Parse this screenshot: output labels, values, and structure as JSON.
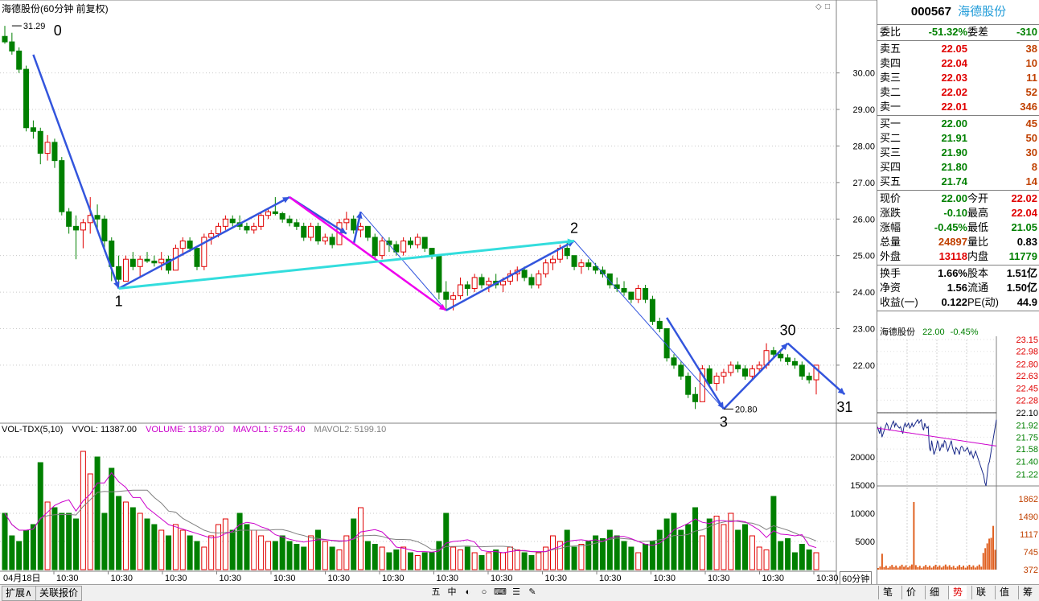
{
  "header": {
    "title": "海德股份(60分钟 前复权)",
    "corner_icons": [
      "◇",
      "□"
    ]
  },
  "chart_data": {
    "type": "candlestick",
    "price_ylim": [
      20.5,
      31.6
    ],
    "price_ticks": [
      "30.00",
      "29.00",
      "28.00",
      "27.00",
      "26.00",
      "25.00",
      "24.00",
      "23.00",
      "22.00"
    ],
    "x_labels": [
      "04月18日",
      "10:30",
      "10:30",
      "10:30",
      "10:30",
      "10:30",
      "10:30",
      "10:30",
      "10:30",
      "10:30",
      "10:30",
      "10:30",
      "10:30",
      "10:30",
      "10:30",
      "10:30"
    ],
    "candles": [
      [
        31.0,
        31.29,
        30.8,
        30.85
      ],
      [
        30.85,
        31.1,
        30.5,
        30.6
      ],
      [
        30.6,
        30.7,
        30.0,
        30.1
      ],
      [
        30.1,
        30.2,
        28.4,
        28.5
      ],
      [
        28.5,
        28.7,
        28.2,
        28.4
      ],
      [
        28.4,
        28.5,
        27.5,
        27.8
      ],
      [
        27.8,
        28.3,
        27.6,
        28.1
      ],
      [
        28.1,
        28.2,
        27.4,
        27.6
      ],
      [
        27.6,
        27.7,
        26.1,
        26.2
      ],
      [
        26.2,
        26.3,
        25.6,
        25.8
      ],
      [
        25.8,
        26.1,
        24.9,
        25.7
      ],
      [
        25.7,
        26.0,
        25.2,
        25.9
      ],
      [
        25.9,
        26.6,
        25.6,
        26.1
      ],
      [
        26.1,
        26.4,
        25.7,
        26.0
      ],
      [
        26.0,
        26.1,
        25.1,
        25.4
      ],
      [
        25.4,
        25.5,
        24.3,
        24.7
      ],
      [
        24.7,
        25.0,
        24.1,
        24.35
      ],
      [
        24.3,
        25.0,
        24.3,
        24.9
      ],
      [
        24.9,
        25.1,
        24.6,
        24.7
      ],
      [
        24.7,
        25.0,
        24.4,
        24.9
      ],
      [
        24.9,
        25.1,
        24.8,
        24.85
      ],
      [
        24.85,
        25.0,
        24.7,
        24.8
      ],
      [
        24.8,
        25.1,
        24.6,
        24.9
      ],
      [
        24.9,
        25.0,
        24.5,
        24.6
      ],
      [
        24.6,
        25.3,
        24.6,
        25.2
      ],
      [
        25.2,
        25.5,
        25.0,
        25.4
      ],
      [
        25.4,
        25.5,
        25.1,
        25.2
      ],
      [
        25.2,
        25.2,
        24.6,
        24.7
      ],
      [
        24.7,
        25.6,
        24.6,
        25.5
      ],
      [
        25.5,
        25.7,
        25.3,
        25.6
      ],
      [
        25.6,
        25.9,
        25.5,
        25.8
      ],
      [
        25.8,
        26.1,
        25.7,
        26.0
      ],
      [
        26.0,
        26.1,
        25.8,
        25.9
      ],
      [
        25.9,
        26.1,
        25.7,
        25.8
      ],
      [
        25.8,
        25.9,
        25.6,
        25.7
      ],
      [
        25.7,
        25.9,
        25.6,
        25.8
      ],
      [
        25.8,
        26.2,
        25.7,
        26.1
      ],
      [
        26.1,
        26.3,
        26.0,
        26.2
      ],
      [
        26.2,
        26.6,
        26.1,
        26.15
      ],
      [
        26.15,
        26.2,
        25.9,
        26.0
      ],
      [
        26.0,
        26.1,
        25.8,
        25.9
      ],
      [
        25.9,
        26.0,
        25.7,
        25.8
      ],
      [
        25.8,
        25.9,
        25.4,
        25.5
      ],
      [
        25.5,
        25.9,
        25.4,
        25.8
      ],
      [
        25.8,
        25.9,
        25.3,
        25.4
      ],
      [
        25.4,
        25.6,
        25.3,
        25.5
      ],
      [
        25.5,
        25.6,
        25.2,
        25.3
      ],
      [
        25.3,
        26.0,
        25.3,
        25.9
      ],
      [
        25.9,
        26.2,
        25.7,
        26.0
      ],
      [
        26.0,
        26.1,
        25.6,
        25.7
      ],
      [
        25.7,
        25.9,
        25.5,
        25.8
      ],
      [
        25.8,
        25.8,
        25.4,
        25.5
      ],
      [
        25.5,
        25.6,
        24.9,
        25.0
      ],
      [
        25.0,
        25.5,
        24.9,
        25.4
      ],
      [
        25.4,
        25.5,
        25.1,
        25.3
      ],
      [
        25.3,
        25.4,
        25.0,
        25.1
      ],
      [
        25.1,
        25.5,
        25.0,
        25.4
      ],
      [
        25.4,
        25.5,
        25.2,
        25.3
      ],
      [
        25.3,
        25.6,
        25.2,
        25.5
      ],
      [
        25.5,
        25.5,
        25.1,
        25.2
      ],
      [
        25.2,
        25.2,
        24.9,
        25.0
      ],
      [
        25.0,
        25.0,
        23.8,
        24.0
      ],
      [
        24.0,
        24.3,
        23.5,
        23.8
      ],
      [
        23.8,
        24.0,
        23.5,
        23.9
      ],
      [
        23.9,
        24.4,
        23.8,
        24.2
      ],
      [
        24.2,
        24.3,
        23.9,
        24.1
      ],
      [
        24.1,
        24.5,
        24.0,
        24.4
      ],
      [
        24.4,
        24.5,
        24.1,
        24.2
      ],
      [
        24.2,
        24.4,
        24.0,
        24.3
      ],
      [
        24.3,
        24.5,
        24.1,
        24.2
      ],
      [
        24.2,
        24.4,
        24.0,
        24.3
      ],
      [
        24.3,
        24.6,
        24.2,
        24.5
      ],
      [
        24.5,
        24.7,
        24.3,
        24.6
      ],
      [
        24.6,
        24.7,
        24.3,
        24.4
      ],
      [
        24.4,
        24.5,
        24.1,
        24.2
      ],
      [
        24.2,
        24.6,
        24.1,
        24.5
      ],
      [
        24.5,
        24.9,
        24.4,
        24.8
      ],
      [
        24.8,
        25.0,
        24.6,
        24.9
      ],
      [
        24.9,
        25.3,
        24.8,
        25.2
      ],
      [
        25.2,
        25.4,
        24.9,
        25.0
      ],
      [
        25.0,
        25.0,
        24.6,
        24.7
      ],
      [
        24.7,
        24.9,
        24.5,
        24.8
      ],
      [
        24.8,
        24.9,
        24.6,
        24.7
      ],
      [
        24.7,
        24.8,
        24.5,
        24.6
      ],
      [
        24.6,
        24.7,
        24.4,
        24.5
      ],
      [
        24.5,
        24.5,
        24.1,
        24.2
      ],
      [
        24.2,
        24.4,
        24.0,
        24.1
      ],
      [
        24.1,
        24.3,
        23.9,
        24.0
      ],
      [
        24.0,
        24.0,
        23.7,
        23.8
      ],
      [
        23.8,
        24.2,
        23.7,
        24.1
      ],
      [
        24.1,
        24.2,
        23.7,
        23.8
      ],
      [
        23.8,
        23.9,
        23.1,
        23.2
      ],
      [
        23.2,
        23.3,
        22.9,
        23.0
      ],
      [
        23.0,
        23.0,
        22.1,
        22.2
      ],
      [
        22.2,
        22.3,
        21.9,
        22.0
      ],
      [
        22.0,
        22.1,
        21.6,
        21.7
      ],
      [
        21.7,
        21.8,
        21.1,
        21.2
      ],
      [
        21.2,
        21.4,
        20.8,
        21.0
      ],
      [
        21.0,
        22.0,
        21.0,
        21.9
      ],
      [
        21.9,
        22.0,
        21.4,
        21.5
      ],
      [
        21.5,
        21.8,
        21.3,
        21.7
      ],
      [
        21.7,
        21.9,
        21.5,
        21.8
      ],
      [
        21.8,
        22.1,
        21.7,
        22.0
      ],
      [
        22.0,
        22.1,
        21.8,
        21.9
      ],
      [
        21.9,
        22.0,
        21.6,
        21.7
      ],
      [
        21.7,
        22.0,
        21.6,
        21.9
      ],
      [
        21.9,
        22.1,
        21.8,
        22.0
      ],
      [
        22.0,
        22.6,
        21.9,
        22.4
      ],
      [
        22.4,
        22.5,
        22.2,
        22.3
      ],
      [
        22.3,
        22.4,
        22.1,
        22.2
      ],
      [
        22.2,
        22.3,
        22.0,
        22.1
      ],
      [
        22.1,
        22.2,
        21.9,
        22.0
      ],
      [
        22.0,
        22.1,
        21.6,
        21.7
      ],
      [
        21.7,
        21.8,
        21.5,
        21.6
      ],
      [
        21.6,
        22.0,
        21.2,
        22.0
      ]
    ],
    "annotations": [
      {
        "label": "0",
        "i": 2,
        "p": 31.29
      },
      {
        "label": "1",
        "i": 16,
        "p": 24.1
      },
      {
        "label": "2",
        "i": 80,
        "p": 25.4
      },
      {
        "label": "3",
        "i": 101,
        "p": 20.8
      },
      {
        "label": "30",
        "i": 110,
        "p": 22.6
      },
      {
        "label": "31",
        "i": 118,
        "p": 21.2
      }
    ],
    "price_labels": [
      {
        "text": "31.29",
        "i": 1,
        "p": 31.29
      },
      {
        "text": "20.80",
        "i": 101,
        "p": 20.8
      }
    ],
    "volume": {
      "ylim": [
        0,
        24000
      ],
      "ticks": [
        "20000",
        "15000",
        "10000",
        "5000"
      ],
      "values": [
        10000,
        6000,
        5000,
        7000,
        8000,
        19000,
        12000,
        11000,
        10000,
        10000,
        9000,
        21000,
        17000,
        20000,
        10000,
        18000,
        13000,
        12000,
        11000,
        10000,
        9000,
        8000,
        7000,
        6000,
        8000,
        7000,
        6000,
        5000,
        4000,
        6000,
        8000,
        9000,
        7000,
        10000,
        8000,
        7000,
        6000,
        5000,
        5000,
        6000,
        5000,
        4500,
        4000,
        6000,
        7000,
        5000,
        4000,
        3500,
        6000,
        9000,
        11000,
        5000,
        4500,
        4000,
        3000,
        3500,
        4000,
        3000,
        2500,
        3000,
        3000,
        5000,
        10000,
        4000,
        3500,
        4000,
        3000,
        2500,
        3000,
        3500,
        3000,
        4000,
        3500,
        3000,
        2500,
        3000,
        4000,
        6000,
        5000,
        7000,
        4000,
        4500,
        5000,
        6000,
        5500,
        7000,
        6000,
        5000,
        4000,
        3000,
        4500,
        5000,
        7000,
        9000,
        10000,
        7000,
        8000,
        11000,
        6000,
        9000,
        9500,
        8000,
        10000,
        7000,
        8000,
        6000,
        4000,
        3500,
        13000,
        5000,
        5500,
        3000,
        4500,
        3500,
        3000,
        4000,
        6000,
        11300
      ],
      "header": {
        "title": "VOL-TDX(5,10)",
        "vvol": "VVOL: 11387.00",
        "volume": "VOLUME: 11387.00",
        "mavol1": "MAVOL1: 5725.40",
        "mavol2": "MAVOL2: 5199.10"
      }
    },
    "colors": {
      "up": "#e00000",
      "down": "#008000",
      "ma5": "#cc00cc",
      "ma10": "#808080",
      "trend": "#3355dd",
      "magenta": "#ee00ee",
      "cyan": "#33dddd"
    }
  },
  "quote": {
    "code": "000567",
    "name": "海德股份",
    "rows": [
      {
        "lab": "委比",
        "v1": "-51.32%",
        "c1": "green",
        "lab2": "委差",
        "v2": "-310",
        "c2": "green"
      },
      {
        "lab": "卖五",
        "v1": "22.05",
        "c1": "red",
        "v2": "38",
        "c2": "brown"
      },
      {
        "lab": "卖四",
        "v1": "22.04",
        "c1": "red",
        "v2": "10",
        "c2": "brown"
      },
      {
        "lab": "卖三",
        "v1": "22.03",
        "c1": "red",
        "v2": "11",
        "c2": "brown"
      },
      {
        "lab": "卖二",
        "v1": "22.02",
        "c1": "red",
        "v2": "52",
        "c2": "brown"
      },
      {
        "lab": "卖一",
        "v1": "22.01",
        "c1": "red",
        "v2": "346",
        "c2": "brown"
      },
      {
        "lab": "买一",
        "v1": "22.00",
        "c1": "green",
        "v2": "45",
        "c2": "brown"
      },
      {
        "lab": "买二",
        "v1": "21.91",
        "c1": "green",
        "v2": "50",
        "c2": "brown"
      },
      {
        "lab": "买三",
        "v1": "21.90",
        "c1": "green",
        "v2": "30",
        "c2": "brown"
      },
      {
        "lab": "买四",
        "v1": "21.80",
        "c1": "green",
        "v2": "8",
        "c2": "brown"
      },
      {
        "lab": "买五",
        "v1": "21.74",
        "c1": "green",
        "v2": "14",
        "c2": "brown"
      },
      {
        "lab": "现价",
        "v1": "22.00",
        "c1": "green",
        "lab2": "今开",
        "v2": "22.02",
        "c2": "red"
      },
      {
        "lab": "涨跌",
        "v1": "-0.10",
        "c1": "green",
        "lab2": "最高",
        "v2": "22.04",
        "c2": "red"
      },
      {
        "lab": "涨幅",
        "v1": "-0.45%",
        "c1": "green",
        "lab2": "最低",
        "v2": "21.05",
        "c2": "green"
      },
      {
        "lab": "总量",
        "v1": "24897",
        "c1": "brown",
        "lab2": "量比",
        "v2": "0.83",
        "c2": "black"
      },
      {
        "lab": "外盘",
        "v1": "13118",
        "c1": "red",
        "lab2": "内盘",
        "v2": "11779",
        "c2": "green"
      },
      {
        "lab": "换手",
        "v1": "1.66%",
        "c1": "black",
        "lab2": "股本",
        "v2": "1.51亿",
        "c2": "black"
      },
      {
        "lab": "净资",
        "v1": "1.56",
        "c1": "black",
        "lab2": "流通",
        "v2": "1.50亿",
        "c2": "black"
      },
      {
        "lab": "收益(一)",
        "v1": "0.122",
        "c1": "black",
        "lab2": "PE(动)",
        "v2": "44.9",
        "c2": "black"
      }
    ]
  },
  "mini": {
    "name": "海德股份",
    "price": "22.00",
    "pct": "-0.45%",
    "price_ticks": [
      "23.15",
      "22.98",
      "22.80",
      "22.63",
      "22.45",
      "22.28",
      "22.10",
      "21.92",
      "21.75",
      "21.58",
      "21.40",
      "21.22"
    ],
    "vol_ticks": [
      "1862",
      "1490",
      "1117",
      "745",
      "372"
    ],
    "ylim": [
      21.05,
      23.15
    ]
  },
  "bottom": {
    "tabs": [
      "扩展∧",
      "关联报价"
    ],
    "tools": [
      "五",
      "中",
      "◐",
      "○",
      "⌨",
      "☰",
      "✎"
    ],
    "period": "60分钟",
    "right_tabs": [
      "笔",
      "价",
      "细",
      "势",
      "联",
      "值",
      "筹"
    ],
    "active_right": "势"
  }
}
